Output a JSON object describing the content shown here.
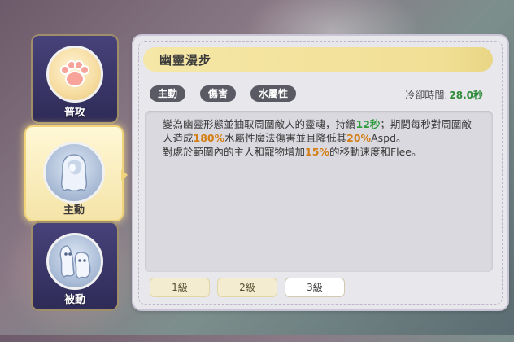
{
  "sidebar": {
    "tabs": [
      {
        "label": "普攻",
        "icon": "paw-icon",
        "active": false
      },
      {
        "label": "主動",
        "icon": "ghost-woman-icon",
        "active": true
      },
      {
        "label": "被動",
        "icon": "ghost-spirits-icon",
        "active": false
      }
    ]
  },
  "skill": {
    "name": "幽靈漫步",
    "tags": [
      "主動",
      "傷害",
      "水屬性"
    ],
    "cooldown_label": "冷卻時間:",
    "cooldown_value": "28.0秒",
    "description": {
      "p1": "變為幽靈形態並抽取周圍敵人的靈魂，持續",
      "p1_value": "12秒",
      "p2": "；期間每秒對周圍敵人造成",
      "p2_value": "180%",
      "p3": "水屬性魔法傷害並且降低其",
      "p3_value": "20%",
      "p4": "Aspd。",
      "p5": "對處於範圍內的主人和寵物增加",
      "p5_value": "15%",
      "p6": "的移動速度和Flee。"
    },
    "levels": [
      "1級",
      "2級",
      "3級"
    ],
    "selected_level_index": 2
  },
  "colors": {
    "highlight_green": "#2e9b3a",
    "highlight_orange": "#d47f16",
    "title_bar": "#f1df95",
    "tag_bg": "#5a5a64"
  }
}
